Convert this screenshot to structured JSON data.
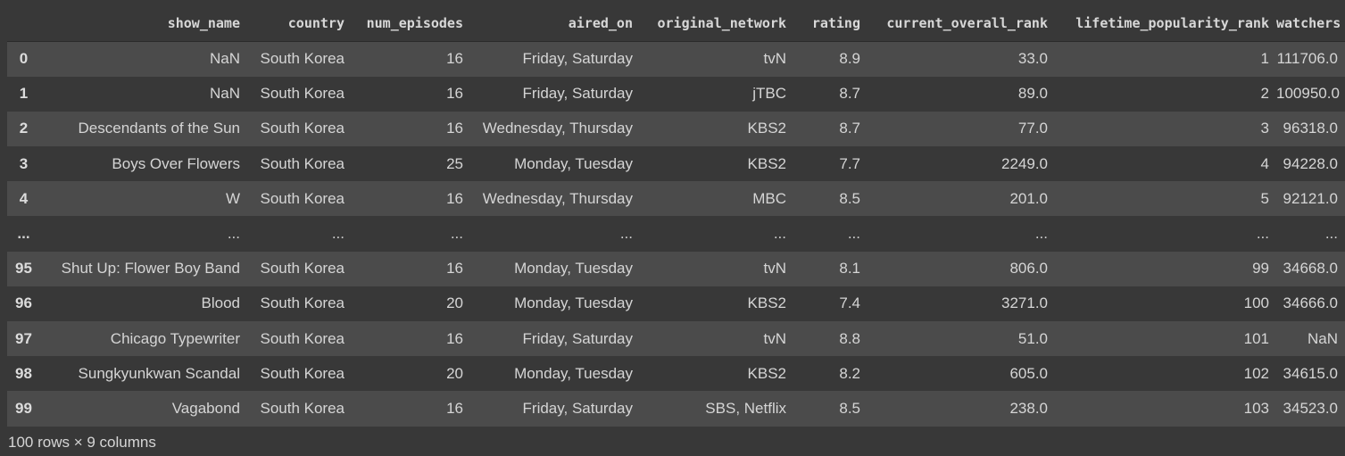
{
  "columns": [
    "",
    "show_name",
    "country",
    "num_episodes",
    "aired_on",
    "original_network",
    "rating",
    "current_overall_rank",
    "lifetime_popularity_rank",
    "watchers"
  ],
  "rows": [
    [
      "0",
      "NaN",
      "South Korea",
      "16",
      "Friday, Saturday",
      "tvN",
      "8.9",
      "33.0",
      "1",
      "111706.0"
    ],
    [
      "1",
      "NaN",
      "South Korea",
      "16",
      "Friday, Saturday",
      "jTBC",
      "8.7",
      "89.0",
      "2",
      "100950.0"
    ],
    [
      "2",
      "Descendants of the Sun",
      "South Korea",
      "16",
      "Wednesday, Thursday",
      "KBS2",
      "8.7",
      "77.0",
      "3",
      "96318.0"
    ],
    [
      "3",
      "Boys Over Flowers",
      "South Korea",
      "25",
      "Monday, Tuesday",
      "KBS2",
      "7.7",
      "2249.0",
      "4",
      "94228.0"
    ],
    [
      "4",
      "W",
      "South Korea",
      "16",
      "Wednesday, Thursday",
      "MBC",
      "8.5",
      "201.0",
      "5",
      "92121.0"
    ],
    [
      "...",
      "...",
      "...",
      "...",
      "...",
      "...",
      "...",
      "...",
      "...",
      "..."
    ],
    [
      "95",
      "Shut Up: Flower Boy Band",
      "South Korea",
      "16",
      "Monday, Tuesday",
      "tvN",
      "8.1",
      "806.0",
      "99",
      "34668.0"
    ],
    [
      "96",
      "Blood",
      "South Korea",
      "20",
      "Monday, Tuesday",
      "KBS2",
      "7.4",
      "3271.0",
      "100",
      "34666.0"
    ],
    [
      "97",
      "Chicago Typewriter",
      "South Korea",
      "16",
      "Friday, Saturday",
      "tvN",
      "8.8",
      "51.0",
      "101",
      "NaN"
    ],
    [
      "98",
      "Sungkyunkwan Scandal",
      "South Korea",
      "20",
      "Monday, Tuesday",
      "KBS2",
      "8.2",
      "605.0",
      "102",
      "34615.0"
    ],
    [
      "99",
      "Vagabond",
      "South Korea",
      "16",
      "Friday, Saturday",
      "SBS, Netflix",
      "8.5",
      "238.0",
      "103",
      "34523.0"
    ]
  ],
  "footer": "100 rows × 9 columns"
}
